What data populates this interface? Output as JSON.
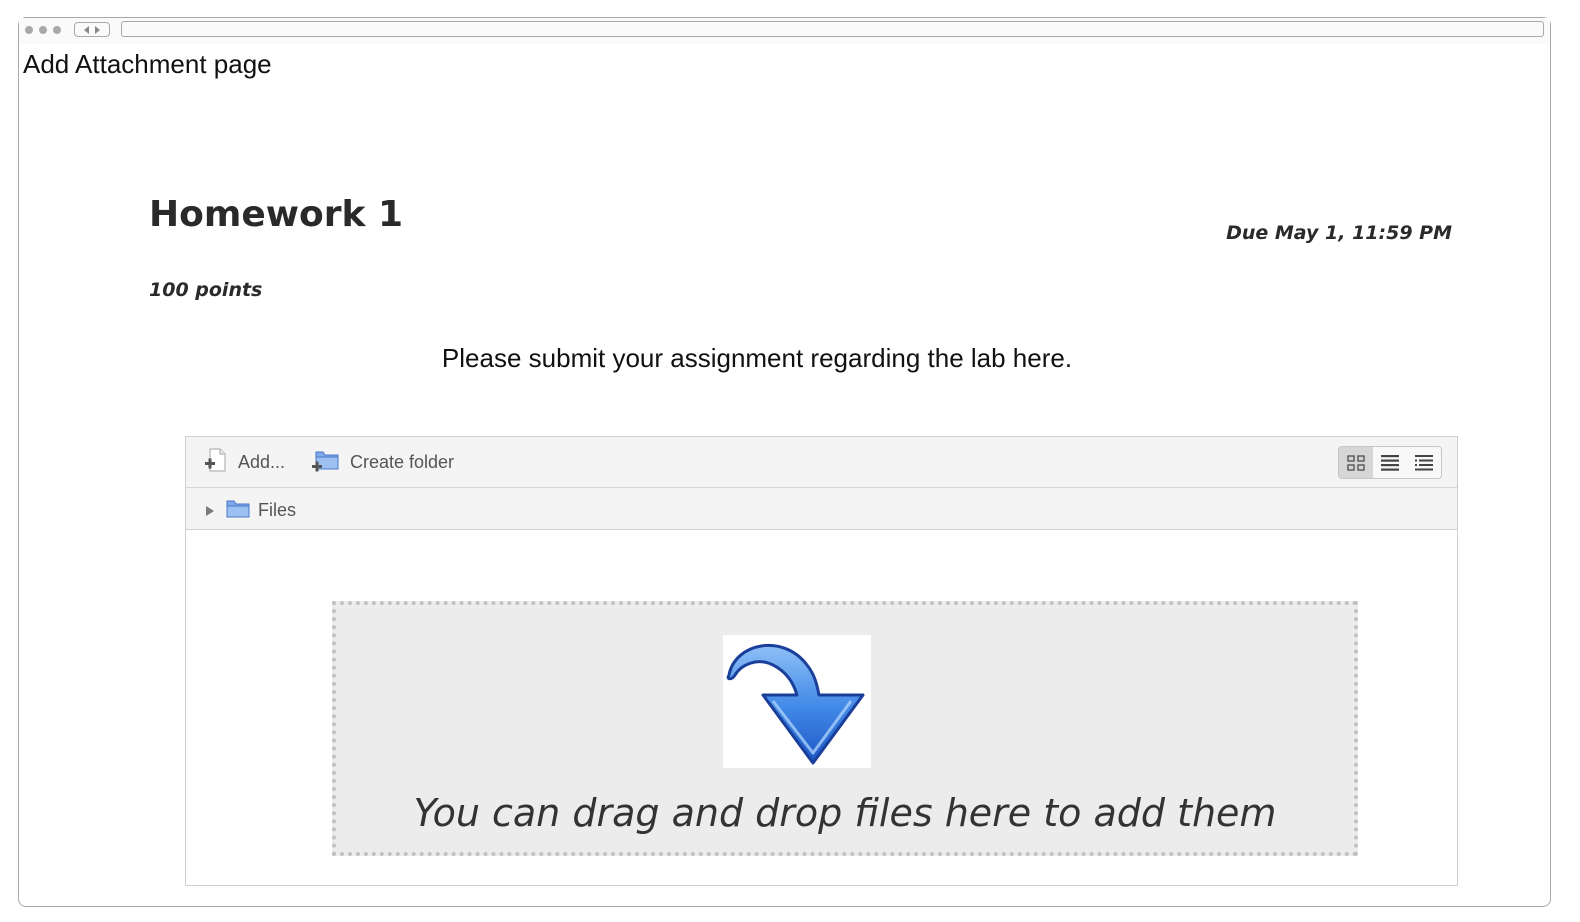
{
  "page": {
    "label": "Add Attachment page"
  },
  "assignment": {
    "title": "Homework 1",
    "due": "Due May 1, 11:59 PM",
    "points": "100 points",
    "instructions": "Please submit your assignment regarding the lab here."
  },
  "filemanager": {
    "toolbar": {
      "add_label": "Add...",
      "create_folder_label": "Create folder",
      "view_modes": [
        "icons-view-icon",
        "list-view-icon",
        "tree-view-icon"
      ],
      "active_view": "icons-view-icon"
    },
    "path": {
      "root_label": "Files"
    },
    "dropzone": {
      "text": "You can drag and drop files here to add them",
      "icon": "down-arrow-icon"
    }
  },
  "colors": {
    "arrow_blue": "#2f6fd8",
    "arrow_light": "#7fb4f4",
    "folder_blue": "#6e9fe6",
    "dropzone_bg": "#ececec"
  }
}
